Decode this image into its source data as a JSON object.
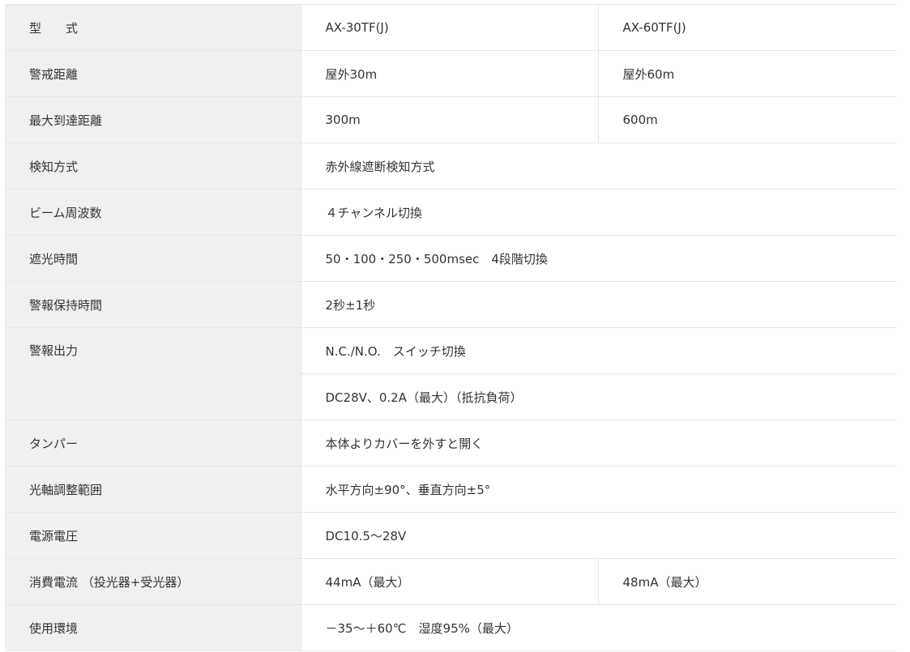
{
  "spec_table": {
    "rows": [
      {
        "label": "型　　式",
        "values": [
          "AX-30TF(J)",
          "AX-60TF(J)"
        ]
      },
      {
        "label": "警戒距離",
        "values": [
          "屋外30m",
          "屋外60m"
        ]
      },
      {
        "label": "最大到達距離",
        "values": [
          "300m",
          "600m"
        ]
      },
      {
        "label": "検知方式",
        "values": [
          "赤外線遮断検知方式"
        ]
      },
      {
        "label": "ビーム周波数",
        "values": [
          "４チャンネル切換"
        ]
      },
      {
        "label": "遮光時間",
        "values": [
          "50・100・250・500msec　4段階切換"
        ]
      },
      {
        "label": "警報保持時間",
        "values": [
          "2秒±1秒"
        ]
      },
      {
        "label": "警報出力",
        "values": [
          "N.C./N.O.　スイッチ切換",
          "DC28V、0.2A（最大）（抵抗負荷）"
        ]
      },
      {
        "label": "タンパー",
        "values": [
          "本体よりカバーを外すと開く"
        ]
      },
      {
        "label": "光軸調整範囲",
        "values": [
          "水平方向±90°、垂直方向±5°"
        ]
      },
      {
        "label": "電源電圧",
        "values": [
          "DC10.5～28V"
        ]
      },
      {
        "label": "消費電流 （投光器+受光器）",
        "values": [
          "44mA（最大）",
          "48mA（最大）"
        ]
      },
      {
        "label": "使用環境",
        "values": [
          "－35～＋60℃　湿度95%（最大）"
        ]
      }
    ]
  },
  "colors": {
    "label_background": "#f0f0f0",
    "border": "#e6e6e6",
    "text": "#333333"
  }
}
